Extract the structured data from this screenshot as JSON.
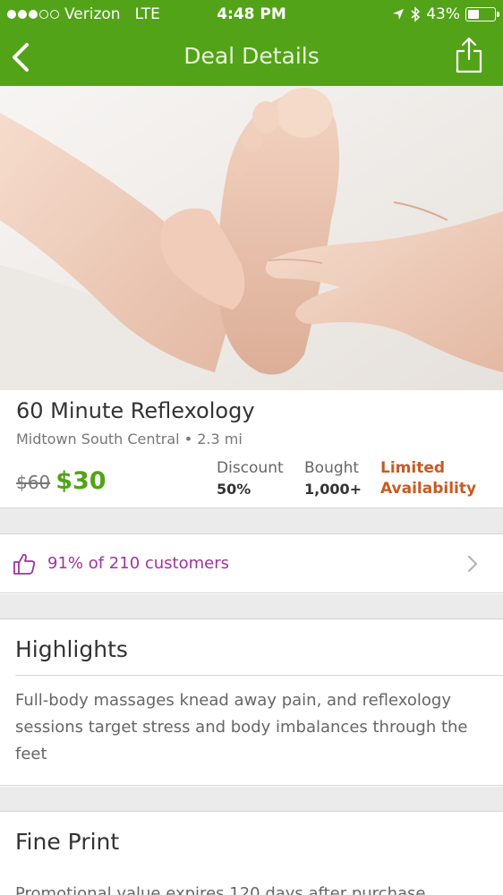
{
  "status_bar": {
    "carrier": "Verizon",
    "network": "LTE",
    "time": "4:48 PM",
    "battery": "43%",
    "battery_level": 0.43,
    "signal_bars_filled": 3,
    "signal_bars_total": 5
  },
  "nav": {
    "title": "Deal Details",
    "back_icon": "chevron-left-icon",
    "share_icon": "share-icon"
  },
  "hero": {
    "image": "foot-reflexology-photo"
  },
  "deal": {
    "name": "60 Minute Reflexology",
    "location": "Midtown South Central • 2.3 mi",
    "original_price": "$60",
    "price": "$30",
    "discount_label": "Discount",
    "discount_value": "50%",
    "bought_label": "Bought",
    "bought_value": "1,000+",
    "availability_line1": "Limited",
    "availability_line2": "Availability"
  },
  "rating": {
    "text": "91% of 210 customers",
    "icon": "thumbs-up-icon"
  },
  "highlights": {
    "heading": "Highlights",
    "body": "Full-body massages knead away pain, and reflexology sessions target stress and body imbalances through the feet"
  },
  "fine_print": {
    "heading": "Fine Print",
    "body": "Promotional value expires 120 days after purchase"
  },
  "colors": {
    "brand_green": "#53a318",
    "rating_purple": "#a0339e",
    "limited_orange": "#c85a23"
  }
}
